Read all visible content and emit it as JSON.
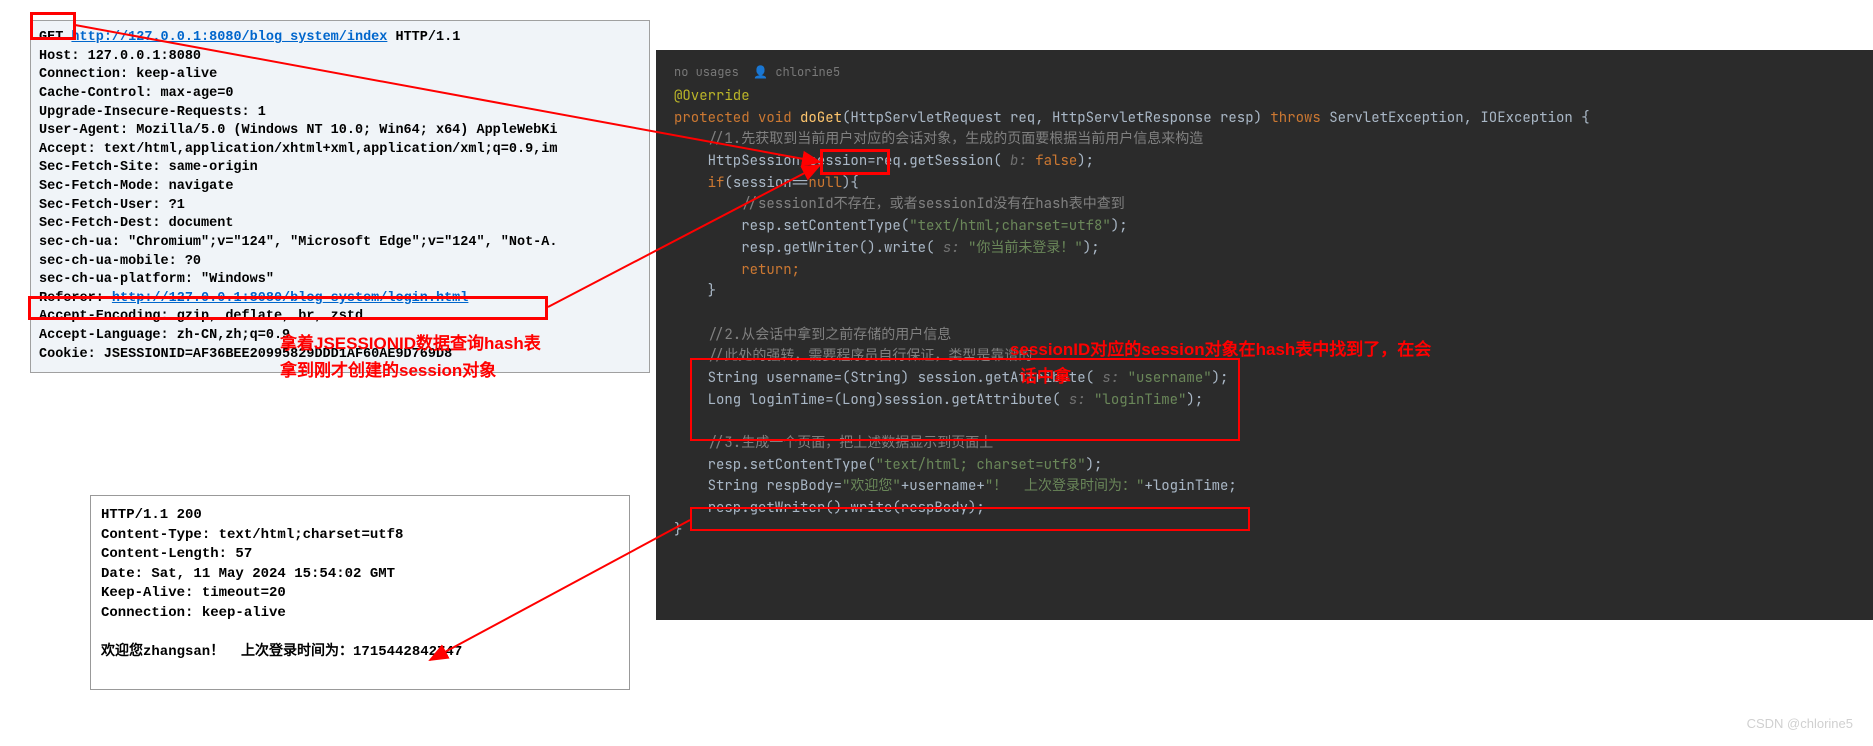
{
  "request": {
    "method": "GET",
    "url": "http://127.0.0.1:8080/blog_system/index",
    "protocol": "HTTP/1.1",
    "host": "Host: 127.0.0.1:8080",
    "connection": "Connection: keep-alive",
    "cache": "Cache-Control: max-age=0",
    "upgrade": "Upgrade-Insecure-Requests: 1",
    "ua": "User-Agent: Mozilla/5.0 (Windows NT 10.0; Win64; x64) AppleWebKi",
    "accept": "Accept: text/html,application/xhtml+xml,application/xml;q=0.9,im",
    "secsite": "Sec-Fetch-Site: same-origin",
    "secmode": "Sec-Fetch-Mode: navigate",
    "secuser": "Sec-Fetch-User: ?1",
    "secdest": "Sec-Fetch-Dest: document",
    "secchua": "sec-ch-ua: \"Chromium\";v=\"124\", \"Microsoft Edge\";v=\"124\", \"Not-A.",
    "secmobile": "sec-ch-ua-mobile: ?0",
    "secplat": "sec-ch-ua-platform: \"Windows\"",
    "referer_label": "Referer: ",
    "referer_url": "http://127.0.0.1:8080/blog_system/login.html",
    "enc": "Accept-Encoding: gzip, deflate, br, zstd",
    "lang": "Accept-Language: zh-CN,zh;q=0.9",
    "cookie": "Cookie: JSESSIONID=AF36BEE20995829DDD1AF60AE9D769D8"
  },
  "anno1_line1": "拿着JSESSIONID数据查询hash表",
  "anno1_line2": "拿到刚才创建的session对象",
  "response": {
    "status": "HTTP/1.1 200",
    "ctype": "Content-Type: text/html;charset=utf8",
    "clen": "Content-Length: 57",
    "date": "Date: Sat, 11 May 2024 15:54:02 GMT",
    "keepalive": "Keep-Alive: timeout=20",
    "conn": "Connection: keep-alive",
    "body": "欢迎您zhangsan！  上次登录时间为：1715442842747"
  },
  "code": {
    "usages": "no usages",
    "author": "chlorine5",
    "override": "@Override",
    "sig1": "protected void ",
    "sig_method": "doGet",
    "sig2": "(HttpServletRequest req, HttpServletResponse resp) ",
    "sig_throws": "throws",
    "sig3": " ServletException, IOException {",
    "c1": "//1.先获取到当前用户对应的会话对象，生成的页面要根据当前用户信息来构造",
    "l1a": "HttpSession ",
    "l1b": "session",
    "l1c": "=req.getSession( ",
    "l1_param": "b: ",
    "l1_false": "false",
    "l1d": ");",
    "l2": "if(session==null){",
    "c2": "//sessionId不存在，或者sessionId没有在hash表中查到",
    "l3a": "resp.setContentType(",
    "l3b": "\"text/html;charset=utf8\"",
    "l3c": ");",
    "l4a": "resp.getWriter().write( ",
    "l4_param": "s: ",
    "l4b": "\"你当前未登录！\"",
    "l4c": ");",
    "l5": "return;",
    "l6": "}",
    "c3": "//2.从会话中拿到之前存储的用户信息",
    "c4": "//此处的强转，需要程序员自行保证，类型是靠谱的",
    "l7a": "String username=(String) session.getAttribute( ",
    "l7_param": "s: ",
    "l7b": "\"username\"",
    "l7c": ");",
    "l8a": "Long loginTime=(Long)session.getAttribute( ",
    "l8_param": "s: ",
    "l8b": "\"loginTime\"",
    "l8c": ");",
    "c5": "//3.生成一个页面，把上述数据显示到页面上",
    "l9a": "resp.setContentType(",
    "l9b": "\"text/html; charset=utf8\"",
    "l9c": ");",
    "l10a": "String respBody=",
    "l10b": "\"欢迎您\"",
    "l10c": "+username+",
    "l10d": "\"！  上次登录时间为：\"",
    "l10e": "+loginTime;",
    "l11": "resp.getWriter().write(respBody);",
    "l12": "}"
  },
  "anno2": "sessionID对应的session对象在hash表中找到了，在会",
  "anno2b": "话中拿",
  "watermark": "CSDN @chlorine5"
}
